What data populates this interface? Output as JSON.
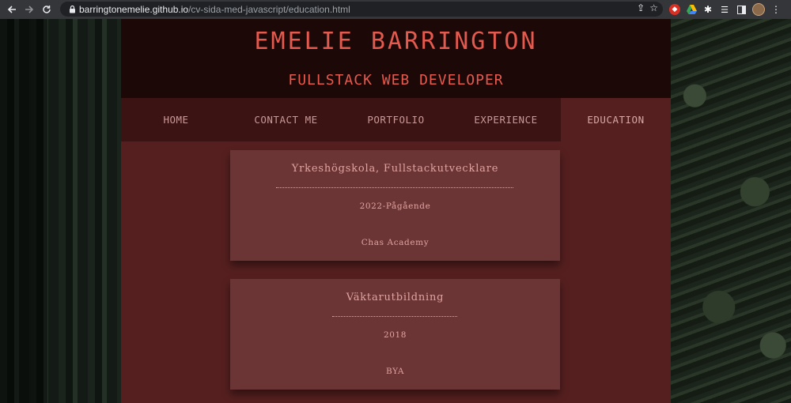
{
  "browser": {
    "url_host": "barringtonemelie.github.io",
    "url_path": "/cv-sida-med-javascript/education.html"
  },
  "header": {
    "name": "EMELIE BARRINGTON",
    "role": "FULLSTACK WEB DEVELOPER"
  },
  "nav": {
    "items": [
      {
        "label": "HOME"
      },
      {
        "label": "CONTACT ME"
      },
      {
        "label": "PORTFOLIO"
      },
      {
        "label": "EXPERIENCE"
      },
      {
        "label": "EDUCATION",
        "active": true
      }
    ]
  },
  "education": [
    {
      "title": "Yrkeshögskola, Fullstackutvecklare",
      "period": "2022-Pågående",
      "school": "Chas Academy"
    },
    {
      "title": "Väktarutbildning",
      "period": "2018",
      "school": "BYA"
    }
  ],
  "colors": {
    "accent": "#e35a4f",
    "header_bg": "#1d0808",
    "nav_bg": "#3b1313",
    "content_bg": "#561f1f",
    "card_bg": "#6c3535",
    "card_text": "#e0a3a1"
  }
}
